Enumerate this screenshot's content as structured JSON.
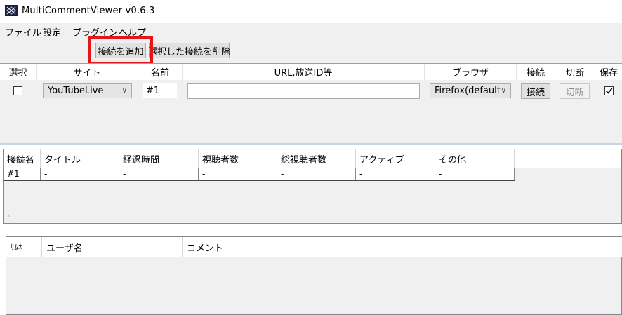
{
  "window": {
    "title": "MultiCommentViewer v0.6.3"
  },
  "menu": {
    "items": [
      "ファイル",
      "設定",
      "プラグイン",
      "ヘルプ"
    ]
  },
  "toolbar": {
    "add_connection": "接続を追加",
    "delete_selected": "選択した接続を削除"
  },
  "connections": {
    "headers": {
      "select": "選択",
      "site": "サイト",
      "name": "名前",
      "url": "URL,放送ID等",
      "browser": "ブラウザ",
      "connect": "接続",
      "disconnect": "切断",
      "save": "保存"
    },
    "row": {
      "selected": false,
      "site": "YouTubeLive",
      "name": "#1",
      "url_value": "",
      "browser": "Firefox(default",
      "connect_label": "接続",
      "disconnect_label": "切断",
      "save_checked": true
    }
  },
  "status_table": {
    "headers": [
      "接続名",
      "タイトル",
      "経過時間",
      "視聴者数",
      "総視聴者数",
      "アクティブ",
      "その他"
    ],
    "rows": [
      [
        "#1",
        "-",
        "-",
        "-",
        "-",
        "-",
        "-"
      ]
    ]
  },
  "comments_table": {
    "headers": [
      "ｻﾑﾈ",
      "ユーザ名",
      "コメント"
    ]
  },
  "colors": {
    "highlight": "#e4161a",
    "panel": "#f0f0f0"
  }
}
